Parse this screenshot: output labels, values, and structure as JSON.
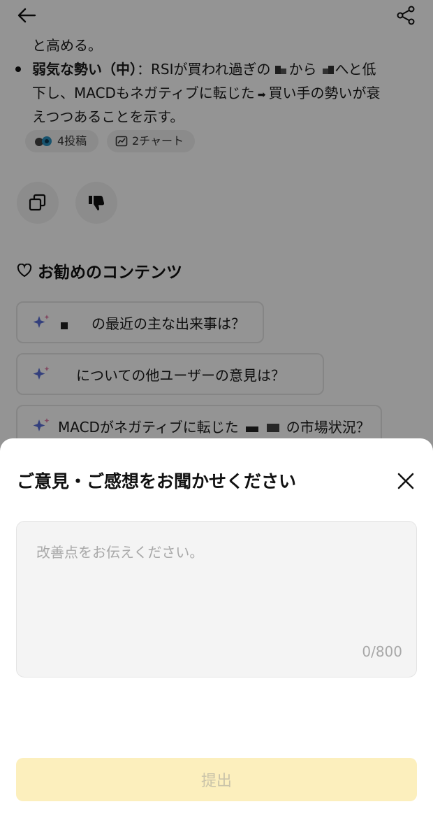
{
  "article": {
    "line1": "と高める。",
    "bullet_bold": "弱気な勢い（中）",
    "bullet_line1_rest": "：RSIが買われ過ぎの",
    "bullet_from": "から",
    "bullet_to": "へと低",
    "bullet_line2": "下し、MACDもネガティブに転じた",
    "bullet_line2_after": "買い手の勢いが衰",
    "bullet_line3": "えつつあることを示す。",
    "chips": {
      "posts": "4投稿",
      "charts": "2チャート"
    }
  },
  "recommended": {
    "title": "お勧めのコンテンツ",
    "items": [
      "の最近の主な出来事は？",
      "についての他ユーザーの意見は？",
      "MACDがネガティブに転じた",
      "の市場状況？"
    ]
  },
  "feedback": {
    "title": "ご意見・ご感想をお聞かせください",
    "placeholder": "改善点をお伝えください。",
    "counter": "0/800",
    "submit": "提出"
  },
  "colors": {
    "overlay": "rgba(0,0,0,0.42)",
    "submit_bg": "#fcefbd",
    "sparkle": "#5b6fd8"
  }
}
